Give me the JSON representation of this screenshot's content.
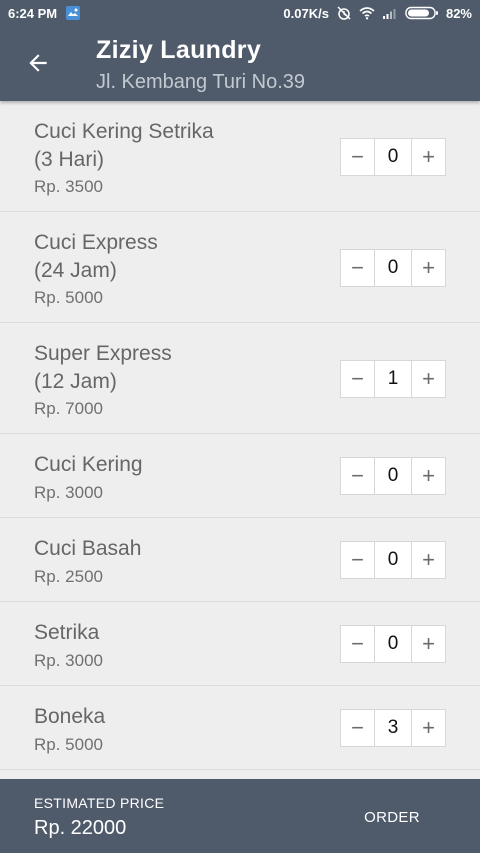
{
  "status_bar": {
    "time": "6:24 PM",
    "net_speed": "0.07K/s",
    "battery": "82%",
    "icons": [
      "gallery-notification-icon",
      "alarm-off-icon",
      "wifi-icon",
      "signal-icon",
      "battery-icon"
    ]
  },
  "toolbar": {
    "title": "Ziziy Laundry",
    "subtitle": "Jl. Kembang Turi No.39",
    "back_icon": "arrow-back-icon"
  },
  "items": [
    {
      "name_lines": [
        "Cuci Kering Setrika",
        "(3 Hari)"
      ],
      "price": "Rp. 3500",
      "qty": "0"
    },
    {
      "name_lines": [
        "Cuci Express",
        "(24 Jam)"
      ],
      "price": "Rp. 5000",
      "qty": "0"
    },
    {
      "name_lines": [
        "Super Express",
        "(12 Jam)"
      ],
      "price": "Rp. 7000",
      "qty": "1"
    },
    {
      "name_lines": [
        "Cuci Kering"
      ],
      "price": "Rp. 3000",
      "qty": "0"
    },
    {
      "name_lines": [
        "Cuci Basah"
      ],
      "price": "Rp. 2500",
      "qty": "0"
    },
    {
      "name_lines": [
        "Setrika"
      ],
      "price": "Rp. 3000",
      "qty": "0"
    },
    {
      "name_lines": [
        "Boneka"
      ],
      "price": "Rp. 5000",
      "qty": "3"
    }
  ],
  "stepper": {
    "minus_symbol": "−",
    "plus_symbol": "+"
  },
  "bottom_bar": {
    "estimated_label": "ESTIMATED PRICE",
    "estimated_value": "Rp. 22000",
    "order_label": "ORDER"
  },
  "colors": {
    "primary": "#4f5b6b",
    "background": "#eeeeee"
  }
}
